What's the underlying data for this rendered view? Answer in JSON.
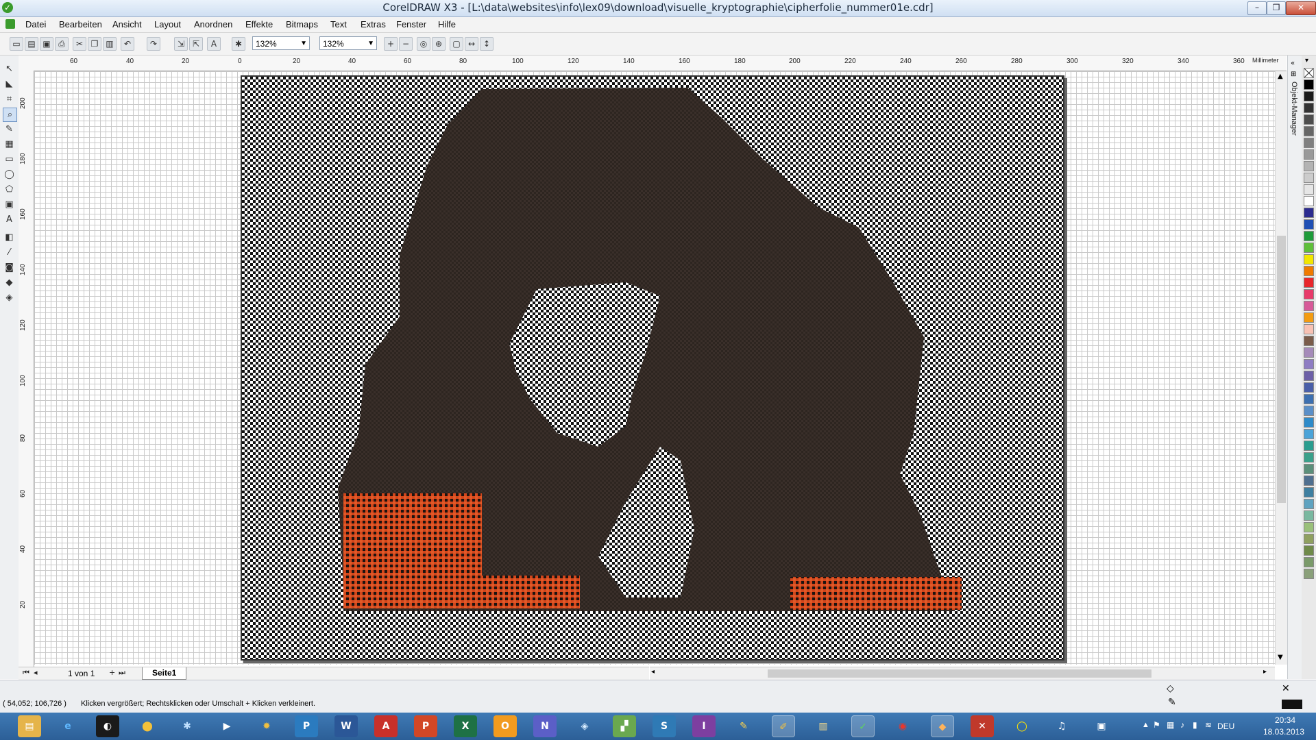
{
  "window": {
    "title": "CorelDRAW X3 - [L:\\data\\websites\\info\\lex09\\download\\visuelle_kryptographie\\cipherfolie_nummer01e.cdr]",
    "controls": {
      "minimize": "–",
      "maximize": "❐",
      "close": "✕"
    }
  },
  "menu": {
    "items": [
      "Datei",
      "Bearbeiten",
      "Ansicht",
      "Layout",
      "Anordnen",
      "Effekte",
      "Bitmaps",
      "Text",
      "Extras",
      "Fenster",
      "Hilfe"
    ]
  },
  "toolbar": {
    "zoom1": "132%",
    "zoom2": "132%"
  },
  "rulers": {
    "unit": "Millimeter",
    "h_ticks": [
      "60",
      "40",
      "20",
      "0",
      "20",
      "40",
      "60",
      "80",
      "100",
      "120",
      "140",
      "160",
      "180",
      "200",
      "220",
      "240",
      "260",
      "280",
      "300",
      "320",
      "340",
      "360"
    ],
    "v_ticks": [
      "200",
      "180",
      "160",
      "140",
      "120",
      "100",
      "80",
      "60",
      "40",
      "20"
    ]
  },
  "docker": {
    "label": "Objekt-Manager"
  },
  "palette": {
    "colors": [
      "#ffffff",
      "#000000",
      "#1a1a1a",
      "#333333",
      "#4d4d4d",
      "#666666",
      "#808080",
      "#999999",
      "#b3b3b3",
      "#cccccc",
      "#e6e6e6",
      "#ffffff",
      "#2b2b8f",
      "#1f4fb4",
      "#1e9b3a",
      "#5fbf3a",
      "#f2e600",
      "#f07a00",
      "#e8262b",
      "#e83a6a",
      "#d75a98",
      "#f39c12",
      "#f8c2b4",
      "#7a5c4a",
      "#a58bb9",
      "#8e7cc3",
      "#6c5fa7",
      "#4a5fa8",
      "#3c6fb0",
      "#5a8fc8",
      "#2e8bc9",
      "#4aa3d8",
      "#2a9d8f",
      "#3aa08a",
      "#5b8f7a",
      "#4f6f8f",
      "#3e7fa0",
      "#5fa3c0",
      "#7ab8a0",
      "#9ac07a",
      "#8fa060",
      "#6f8a4a",
      "#7a9a6a",
      "#8aa07a"
    ]
  },
  "pagenav": {
    "counter": "1 von 1",
    "tab": "Seite1"
  },
  "status": {
    "coords": "( 54,052; 106,726 )",
    "hint": "Klicken vergrößert; Rechtsklicken oder Umschalt + Klicken verkleinert."
  },
  "taskbar": {
    "lang": "DEU",
    "time": "20:34",
    "date": "18.03.2013"
  }
}
